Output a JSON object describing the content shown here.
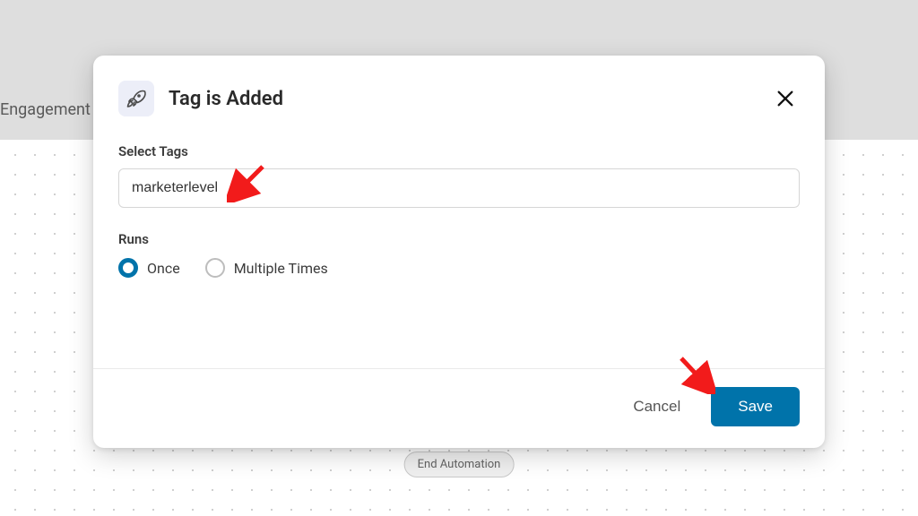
{
  "background": {
    "tab_label": "Engagement",
    "end_chip": "End Automation"
  },
  "modal": {
    "title": "Tag is Added",
    "icon_name": "rocket-icon",
    "select_tags_label": "Select Tags",
    "tag_value": "marketerlevel",
    "runs_label": "Runs",
    "runs_options": {
      "once": "Once",
      "multiple": "Multiple Times"
    },
    "runs_selected": "once",
    "footer": {
      "cancel": "Cancel",
      "save": "Save"
    }
  },
  "colors": {
    "accent": "#0073aa"
  }
}
